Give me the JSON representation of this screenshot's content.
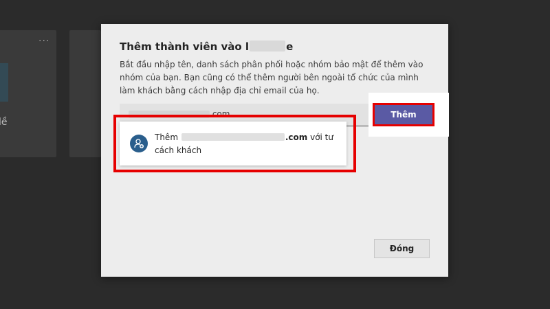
{
  "background": {
    "more_label": "···",
    "partial_text": "lề"
  },
  "dialog": {
    "title": "Thêm thành viên vào l",
    "title_suffix": "e",
    "description": "Bắt đầu nhập tên, danh sách phân phối hoặc nhóm bảo mật để thêm vào nhóm của bạn. Bạn cũng có thể thêm người bên ngoài tổ chức của mình làm khách bằng cách nhập địa chỉ email của họ.",
    "input_value": ".com",
    "add_button": "Thêm",
    "suggestion": {
      "prefix": "Thêm",
      "email_suffix": ".com",
      "rest": "với tư cách khách"
    },
    "close_button": "Đóng"
  },
  "colors": {
    "primary": "#5a5aa4",
    "highlight": "#e60000",
    "avatar": "#2a5e8c"
  }
}
